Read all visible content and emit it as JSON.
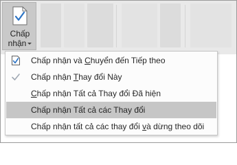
{
  "ribbon": {
    "accept_button": {
      "line1": "Chấp",
      "line2": "nhận",
      "icon": "document-check-icon"
    }
  },
  "menu": {
    "items": [
      {
        "pre": "Chấp nhận và ",
        "key": "C",
        "post": "huyển đến Tiếp theo",
        "icon": "document-check-icon",
        "highlighted": false
      },
      {
        "pre": "Chấp nhận ",
        "key": "T",
        "post": "hay đổi Này",
        "icon": "check-icon",
        "highlighted": false
      },
      {
        "pre": "",
        "key": "C",
        "post": "hấp nhận Tất cả Thay đổi Đã hiện",
        "icon": "",
        "highlighted": false
      },
      {
        "pre": "Chấp nhận Tất cả các Thay đổi",
        "key": "",
        "post": "",
        "icon": "",
        "highlighted": true
      },
      {
        "pre": "Chấp nhận tất cả các thay đổi ",
        "key": "v",
        "post": "à dừng theo dõi",
        "icon": "",
        "highlighted": false
      }
    ]
  },
  "colors": {
    "ribbon_bg": "#e9e9e9",
    "button_pressed_bg": "#c9c9c9",
    "menu_highlight": "#c6c6c6",
    "check_blue": "#2b73c4"
  }
}
